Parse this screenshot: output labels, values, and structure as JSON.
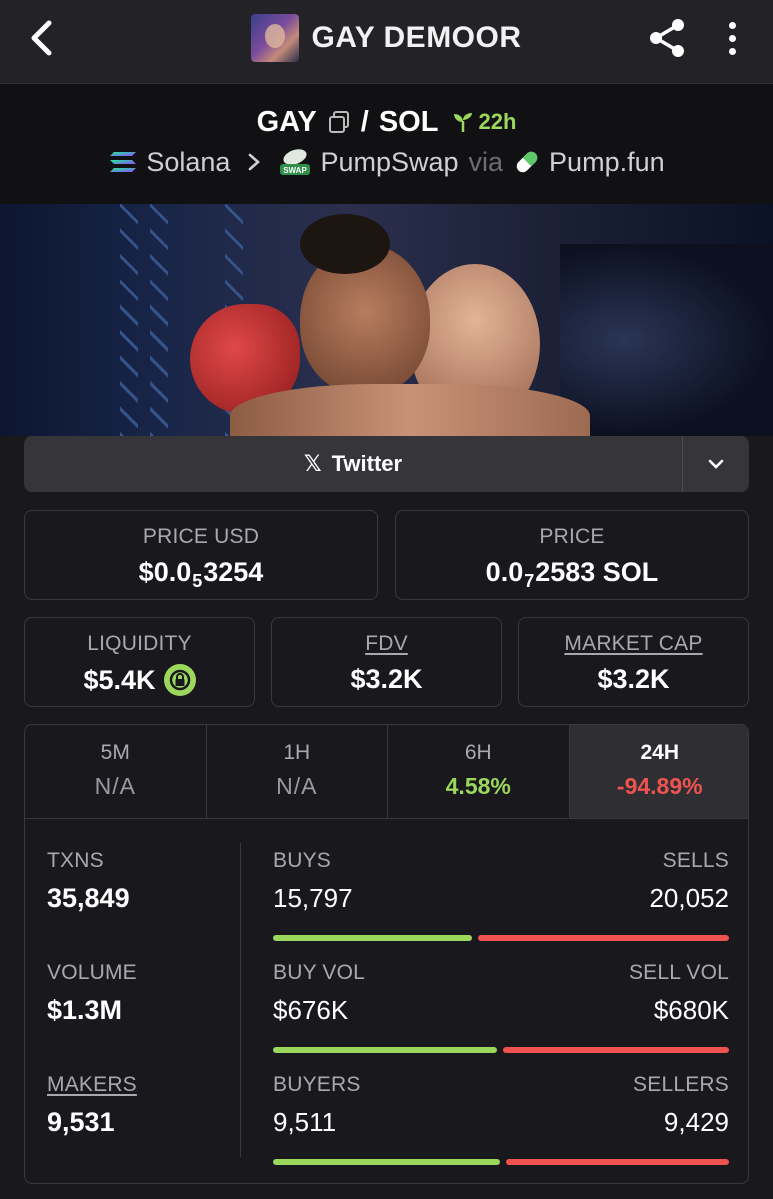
{
  "header": {
    "title": "GAY DEMOOR"
  },
  "pair": {
    "base": "GAY",
    "separator": "/",
    "quote": "SOL",
    "age": "22h"
  },
  "chain": {
    "network": "Solana",
    "dex": "PumpSwap",
    "via": "via",
    "launchpad": "Pump.fun",
    "dex_badge": "SWAP"
  },
  "twitter": {
    "glyph": "𝕏",
    "label": "Twitter"
  },
  "price_cards": {
    "price_usd": {
      "label": "PRICE USD",
      "prefix": "$0.0",
      "zeros": "5",
      "digits": "3254"
    },
    "price_sol": {
      "label": "PRICE",
      "prefix": "0.0",
      "zeros": "7",
      "digits": "2583 SOL"
    }
  },
  "metrics": {
    "liquidity": {
      "label": "LIQUIDITY",
      "value": "$5.4K"
    },
    "fdv": {
      "label": "FDV",
      "value": "$3.2K"
    },
    "market_cap": {
      "label": "MARKET CAP",
      "value": "$3.2K"
    }
  },
  "tabs": [
    {
      "label": "5M",
      "value": "N/A"
    },
    {
      "label": "1H",
      "value": "N/A"
    },
    {
      "label": "6H",
      "value": "4.58%"
    },
    {
      "label": "24H",
      "value": "-94.89%"
    }
  ],
  "stats": {
    "txns": {
      "label": "TXNS",
      "value": "35,849"
    },
    "volume": {
      "label": "VOLUME",
      "value": "$1.3M"
    },
    "makers": {
      "label": "MAKERS",
      "value": "9,531"
    },
    "buys": {
      "label": "BUYS",
      "value": "15,797"
    },
    "sells": {
      "label": "SELLS",
      "value": "20,052"
    },
    "buy_vol": {
      "label": "BUY VOL",
      "value": "$676K"
    },
    "sell_vol": {
      "label": "SELL VOL",
      "value": "$680K"
    },
    "buyers": {
      "label": "BUYERS",
      "value": "9,511"
    },
    "sellers": {
      "label": "SELLERS",
      "value": "9,429"
    }
  },
  "colors": {
    "positive": "#9bd65d",
    "negative": "#ef5350",
    "background": "#19191d"
  }
}
